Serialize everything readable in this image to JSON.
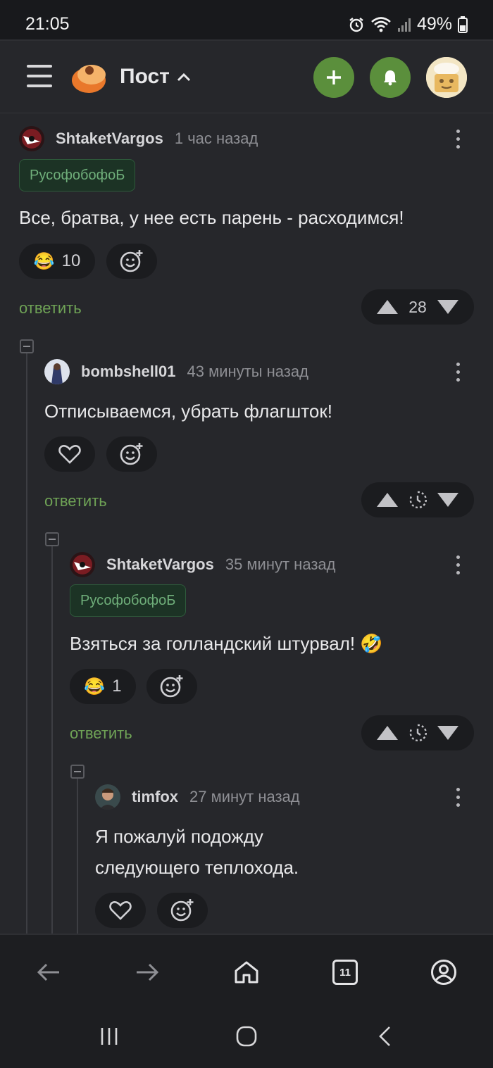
{
  "status_bar": {
    "time": "21:05",
    "battery": "49%",
    "icons": [
      "alarm-icon",
      "wifi-icon",
      "signal-icon",
      "battery-icon"
    ]
  },
  "app_bar": {
    "title": "Пост",
    "icons": [
      "menu-icon",
      "logo-icon",
      "chevron-up-icon",
      "add-icon",
      "bell-icon",
      "avatar-icon"
    ],
    "accent": "#5b8f3c"
  },
  "comments": [
    {
      "author": "ShtaketVargos",
      "time": "1 час назад",
      "tag": "РусофобофоБ",
      "text": "Все, братва, у нее есть парень - расходимся!",
      "reaction_count": "10",
      "reply_label": "ответить",
      "score": "28"
    },
    {
      "author": "bombshell01",
      "time": "43 минуты назад",
      "text": "Отписываемся, убрать флагшток!",
      "reply_label": "ответить"
    },
    {
      "author": "ShtaketVargos",
      "time": "35 минут назад",
      "tag": "РусофобофоБ",
      "text": "Взяться за голландский штурвал! 🤣",
      "reaction_count": "1",
      "reply_label": "ответить"
    },
    {
      "author": "timfox",
      "time": "27 минут назад",
      "text_line1": "Я пожалуй подожду",
      "text_line2": "следующего теплохода."
    }
  ],
  "bottom_nav": {
    "tabs_count": "11",
    "icons": [
      "back-arrow-icon",
      "forward-arrow-icon",
      "home-icon",
      "tabs-icon",
      "profile-icon"
    ]
  },
  "system_nav": {
    "icons": [
      "recent-apps-icon",
      "home-circle-icon",
      "system-back-icon"
    ]
  }
}
